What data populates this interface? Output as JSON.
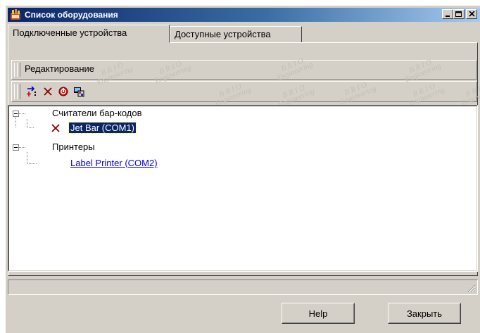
{
  "window": {
    "title": "Список оборудования"
  },
  "tabs": [
    {
      "label": "Подключенные устройства",
      "active": true
    },
    {
      "label": "Доступные устройства",
      "active": false
    }
  ],
  "menu": {
    "editing_label": "Редактирование"
  },
  "toolbar": {
    "tools": [
      "add-device-icon",
      "delete-icon",
      "disconnect-icon",
      "properties-icon"
    ]
  },
  "watermark": {
    "line1": "B R I O",
    "line2": "Engineering"
  },
  "tree": {
    "groups": [
      {
        "label": "Считатели бар-кодов",
        "children": [
          {
            "label": "Jet Bar (COM1)",
            "status": "error",
            "selected": true
          }
        ]
      },
      {
        "label": "Принтеры",
        "children": [
          {
            "label": "Label Printer (COM2)",
            "status": "ok",
            "selected": false
          }
        ]
      }
    ]
  },
  "buttons": {
    "help": "Help",
    "close": "Закрыть"
  },
  "colors": {
    "title_bar": "#0a246a",
    "selection": "#0a246a",
    "error_icon": "#8b0000",
    "link": "#0000ee"
  }
}
